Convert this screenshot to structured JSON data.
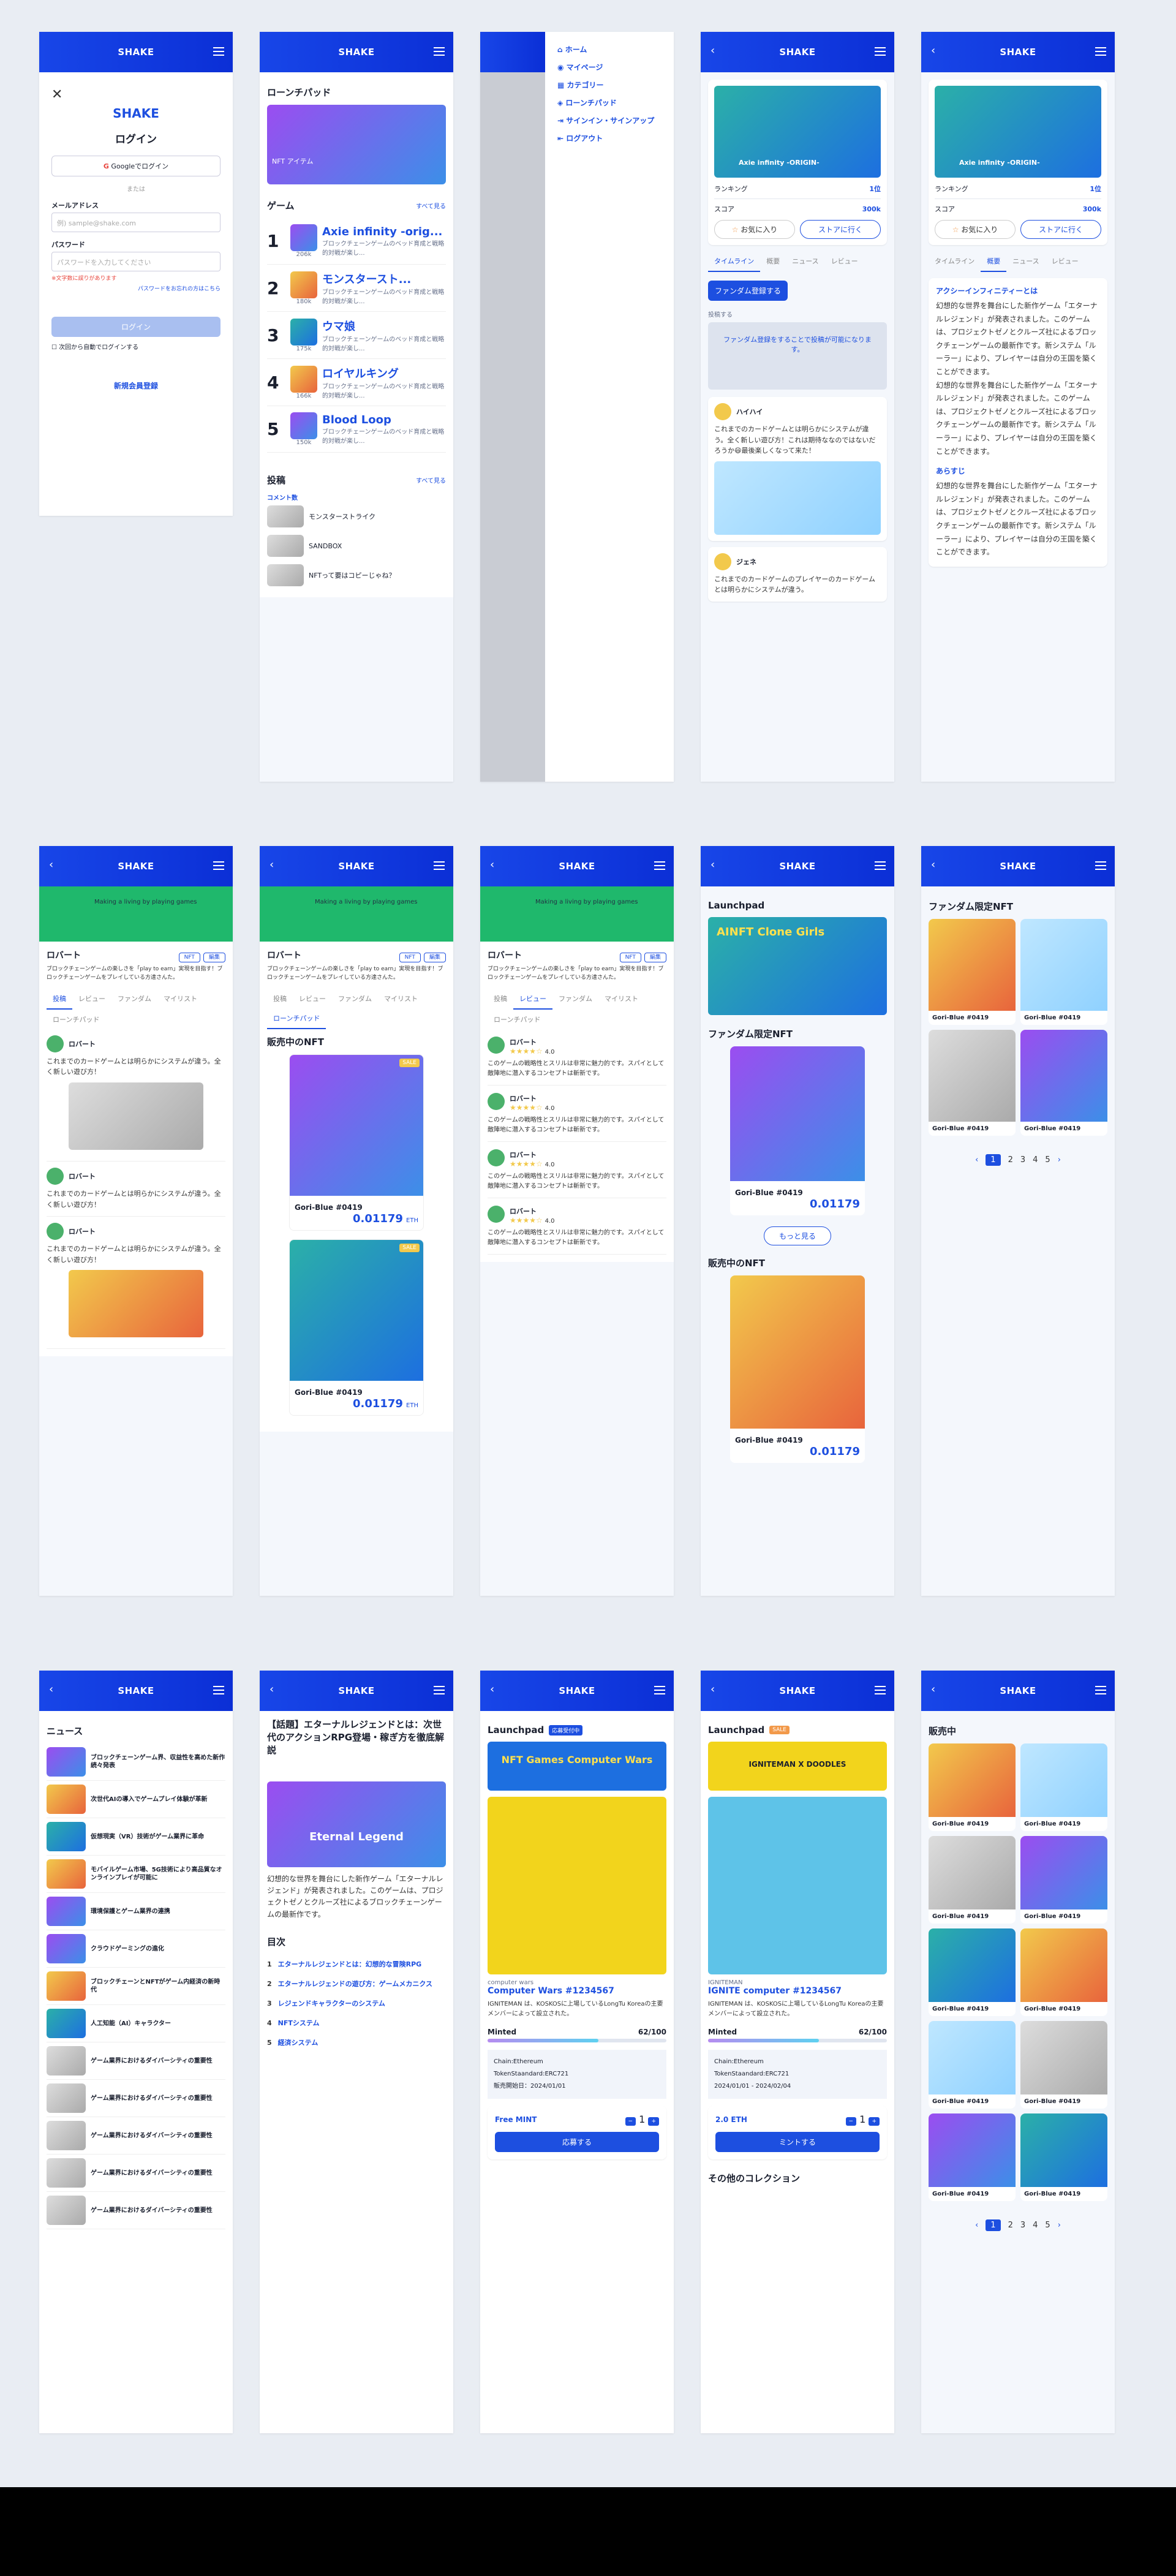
{
  "brand": "SHAKE",
  "login": {
    "title": "ログイン",
    "google": "Googleでログイン",
    "or": "または",
    "email_label": "メールアドレス",
    "email_ph": "例) sample@shake.com",
    "pw_label": "パスワード",
    "pw_ph": "パスワードを入力してください",
    "pw_err": "※文字数に誤りがあります",
    "forgot": "パスワードをお忘れの方はこちら",
    "btn": "ログイン",
    "remember": "次回から自動でログインする",
    "register": "新規会員登録"
  },
  "home": {
    "launchpad": "ローンチパッド",
    "nft_label": "NFT アイテム",
    "games_title": "ゲーム",
    "see_all": "すべて見る",
    "games": [
      {
        "rank": "1",
        "name": "Axie infinity -orig...",
        "score": "206k"
      },
      {
        "rank": "2",
        "name": "モンスタースト...",
        "score": "180k"
      },
      {
        "rank": "3",
        "name": "ウマ娘",
        "score": "175k"
      },
      {
        "rank": "4",
        "name": "ロイヤルキング",
        "score": "166k"
      },
      {
        "rank": "5",
        "name": "Blood Loop",
        "score": "150k"
      }
    ],
    "desc": "ブロックチェーンゲームのベッド育成と戦略的対戦が楽し...",
    "posts_title": "投稿",
    "comments": "コメント数",
    "posts": [
      "モンスターストライク",
      "SANDBOX",
      "NFTって要はコピーじゃね？"
    ]
  },
  "menu": {
    "items": [
      "ホーム",
      "マイページ",
      "カテゴリー",
      "ローンチパッド",
      "サインイン・サインアップ",
      "ログアウト"
    ]
  },
  "game": {
    "name": "Axie infinity -ORIGIN-",
    "ranking": "ランキング",
    "rank_val": "1位",
    "score": "スコア",
    "score_val": "300k",
    "fav": "お気に入り",
    "store": "ストアに行く",
    "tabs": [
      "タイムライン",
      "概要",
      "ニュース",
      "レビュー"
    ],
    "join": "ファンダム登録する",
    "post_label": "投稿する",
    "overlay": "ファンダム登録をすることで投稿が可能になります。",
    "user1": "ハイハイ",
    "user1_text": "これまでのカードゲームとは明らかにシステムが違う。全く新しい遊び方！これは期待ななのではないだろうか😄最後楽しくなって来た！",
    "user2": "ジェネ",
    "user2_text": "これまでのカードゲームのプレイヤーのカードゲームとは明らかにシステムが違う。",
    "about_title": "アクシーインフィニティーとは",
    "about": "幻想的な世界を舞台にした新作ゲーム「エターナルレジェンド」が発表されました。このゲームは、プロジェクトゼノとクルーズ社によるブロックチェーンゲームの最新作です。新システム「ルーラー」により、プレイヤーは自分の王国を築くことができます。",
    "rules": "あらすじ"
  },
  "profile": {
    "name": "ロバート",
    "banner": "Making a living by playing games",
    "nft_btn": "NFT",
    "edit": "編集",
    "bio": "ブロックチェーンゲームの楽しさを「play to earn」実現を目指す！ブロックチェーンゲームをプレイしている方達さんた。",
    "tabs": [
      "投稿",
      "レビュー",
      "ファンダム",
      "マイリスト",
      "ローンチパッド"
    ],
    "post": "これまでのカードゲームとは明らかにシステムが違う。全く新しい遊び方！",
    "selling": "販売中のNFT",
    "nft_name": "Gori-Blue #0419",
    "nft_price": "0.01179",
    "eth": "ETH",
    "sale": "SALE",
    "rating": "4.0",
    "review": "このゲームの戦略性とスリルは非常に魅力的です。スパイとして敵陣地に潜入するコンセプトは斬新です。"
  },
  "lp": {
    "title": "Launchpad",
    "banner": "AINFT Clone Girls",
    "fandom": "ファンダム限定NFT",
    "more": "もっと見る",
    "selling": "販売中のNFT",
    "nft": "Gori-Blue #0419",
    "price": "0.01179",
    "pages": [
      "1",
      "2",
      "3",
      "4",
      "5"
    ]
  },
  "news": {
    "title": "ニュース",
    "items": [
      "ブロックチェーンゲーム界、収益性を高めた新作続々発表",
      "次世代AIの導入でゲームプレイ体験が革新",
      "仮想現実（VR）技術がゲーム業界に革命",
      "モバイルゲーム市場、5G技術により高品質なオンラインプレイが可能に",
      "環境保護とゲーム業界の連携",
      "クラウドゲーミングの進化",
      "ブロックチェーンとNFTがゲーム内経済の新時代",
      "人工知能（AI）キャラクター",
      "ゲーム業界におけるダイバーシティの重要性",
      "ゲーム業界におけるダイバーシティの重要性",
      "ゲーム業界におけるダイバーシティの重要性",
      "ゲーム業界におけるダイバーシティの重要性",
      "ゲーム業界におけるダイバーシティの重要性"
    ]
  },
  "article": {
    "title": "【話題】エターナルレジェンドとは：次世代のアクションRPG登場・稼ぎ方を徹底解説",
    "hero": "Eternal Legend",
    "body": "幻想的な世界を舞台にした新作ゲーム「エターナルレジェンド」が発表されました。このゲームは、プロジェクトゼノとクルーズ社によるブロックチェーンゲームの最新作です。",
    "toc": "目次",
    "toc_items": [
      "エターナルレジェンドとは：幻想的な冒険RPG",
      "エターナルレジェンドの遊び方：ゲームメカニクス",
      "レジェンドキャラクターのシステム",
      "NFTシステム",
      "経済システム"
    ]
  },
  "mint1": {
    "title": "Launchpad",
    "tag": "応募受付中",
    "banner": "NFT Games Computer Wars",
    "sub": "computer wars",
    "name": "Computer Wars #1234567",
    "desc": "IGNITEMAN は、KOSKOSに上場しているLongTu Koreaの主要メンバーによって設立された。",
    "minted": "Minted",
    "count": "62/100",
    "chain": "Chain:Ethereum",
    "token": "TokenStaandard:ERC721",
    "date": "販売開始日：2024/01/01",
    "free": "Free MINT",
    "qty": "1",
    "apply": "応募する"
  },
  "mint2": {
    "title": "Launchpad",
    "tag": "SALE",
    "banner": "IGNITEMAN X DOODLES",
    "sub": "IGNITEMAN",
    "name": "IGNITE computer #1234567",
    "minted": "Minted",
    "count": "62/100",
    "chain": "Chain:Ethereum",
    "token": "TokenStaandard:ERC721",
    "date": "2024/01/01 - 2024/02/04",
    "price": "2.0 ETH",
    "qty": "1",
    "mint": "ミントする",
    "other": "その他のコレクション"
  },
  "grid": {
    "title": "ファンダム限定NFT",
    "sell_title": "販売中",
    "nft": "Gori-Blue #0419",
    "pages": [
      "1",
      "2",
      "3",
      "4",
      "5"
    ]
  }
}
